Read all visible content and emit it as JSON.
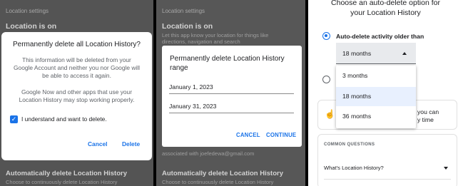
{
  "screen1": {
    "background": {
      "settings_label": "Location settings",
      "location_heading": "Location is on",
      "auto_delete_heading": "Automatically delete Location History",
      "auto_delete_text": "Choose to continuously delete Location History"
    },
    "dialog": {
      "title": "Permanently delete all Location History?",
      "body1": [
        "This information will be deleted from your",
        "Google Account and neither you nor Google will",
        "be able to access it again."
      ],
      "body2": [
        "Google Now and other apps that use your",
        "Location History may stop working properly."
      ],
      "checkbox_label": "I understand and want to delete.",
      "checkbox_checked": true,
      "cancel_label": "Cancel",
      "delete_label": "Delete"
    }
  },
  "screen2": {
    "background": {
      "settings_label": "Location settings",
      "location_heading": "Location is on",
      "location_text": [
        "Let this app know your location for things like",
        "directions, navigation and search"
      ],
      "account_text": "associated with joefedewa@gmail.com",
      "auto_delete_heading": "Automatically delete Location History",
      "auto_delete_text": "Choose to continuously delete Location History"
    },
    "dialog": {
      "title": [
        "Permanently delete Location History",
        "range"
      ],
      "start_date": "January 1, 2023",
      "end_date": "January 31, 2023",
      "cancel_label": "CANCEL",
      "continue_label": "CONTINUE"
    }
  },
  "screen3": {
    "title": [
      "Choose an auto-delete option for",
      "your Location History"
    ],
    "option_label": "Auto-delete activity older than",
    "selected_value": "18 months",
    "menu_options": [
      "3 months",
      "18 months",
      "36 months"
    ],
    "menu_selected_index": 1,
    "card_text": [
      "you can",
      "y time"
    ],
    "common_questions_label": "COMMON QUESTIONS",
    "faq_item": "What's Location History?",
    "accent_color": "#1a73e8"
  }
}
